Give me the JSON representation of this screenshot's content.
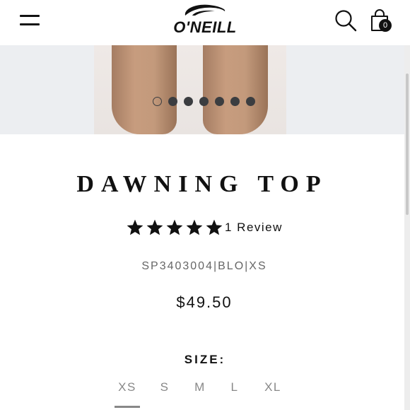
{
  "header": {
    "brand": "O'NEILL",
    "menu_icon": "hamburger-menu-icon",
    "search_icon": "search-icon",
    "bag_icon": "shopping-bag-icon",
    "bag_count": "0"
  },
  "gallery": {
    "slide_count": 7,
    "active_slide": 1
  },
  "product": {
    "title": "DAWNING TOP",
    "rating_stars": 5,
    "review_label": "1 Review",
    "sku": "SP3403004|BLO|XS",
    "price": "$49.50"
  },
  "size_selector": {
    "label": "SIZE:",
    "options": [
      "XS",
      "S",
      "M",
      "L",
      "XL"
    ],
    "selected": "XS"
  },
  "colors": {
    "text": "#111111",
    "muted": "#888888",
    "hero_bg": "#eceef1"
  }
}
